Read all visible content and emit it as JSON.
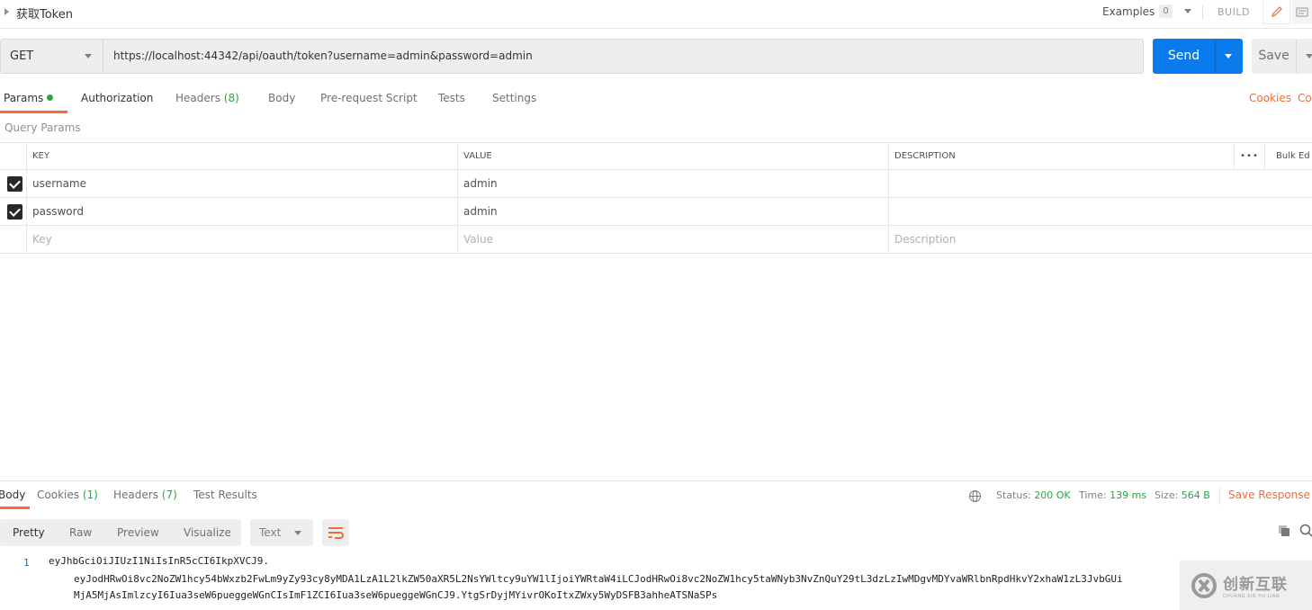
{
  "request": {
    "name": "获取Token",
    "examples_label": "Examples",
    "examples_count": "0",
    "build_label": "BUILD",
    "method": "GET",
    "url": "https://localhost:44342/api/oauth/token?username=admin&password=admin",
    "send_label": "Send",
    "save_label": "Save"
  },
  "request_tabs": [
    {
      "label": "Params",
      "suffix": "",
      "active": true,
      "has_dot": true
    },
    {
      "label": "Authorization",
      "suffix": ""
    },
    {
      "label": "Headers",
      "suffix": "(8)"
    },
    {
      "label": "Body",
      "suffix": ""
    },
    {
      "label": "Pre-request Script",
      "suffix": ""
    },
    {
      "label": "Tests",
      "suffix": ""
    },
    {
      "label": "Settings",
      "suffix": ""
    }
  ],
  "right_links": {
    "cookies": "Cookies",
    "code": "Co"
  },
  "query_params": {
    "section_label": "Query Params",
    "headers": {
      "key": "KEY",
      "value": "VALUE",
      "description": "DESCRIPTION",
      "more": "•••",
      "bulk_edit": "Bulk Ed"
    },
    "rows": [
      {
        "checked": true,
        "key": "username",
        "value": "admin",
        "description": ""
      },
      {
        "checked": true,
        "key": "password",
        "value": "admin",
        "description": ""
      }
    ],
    "placeholders": {
      "key": "Key",
      "value": "Value",
      "description": "Description"
    }
  },
  "response": {
    "tabs": [
      {
        "label": "Body",
        "suffix": "",
        "active": true
      },
      {
        "label": "Cookies",
        "suffix": "(1)"
      },
      {
        "label": "Headers",
        "suffix": "(7)"
      },
      {
        "label": "Test Results",
        "suffix": ""
      }
    ],
    "status_label": "Status:",
    "status_value": "200 OK",
    "time_label": "Time:",
    "time_value": "139 ms",
    "size_label": "Size:",
    "size_value": "564 B",
    "save_response": "Save Response",
    "formats": [
      "Pretty",
      "Raw",
      "Preview",
      "Visualize"
    ],
    "active_format": "Pretty",
    "type_select": "Text",
    "body_line_number": "1",
    "body_lines": [
      "eyJhbGciOiJIUzI1NiIsInR5cCI6IkpXVCJ9.",
      "eyJodHRwOi8vc2NoZW1hcy54bWxzb2FwLm9yZy93cy8yMDA1LzA1L2lkZW50aXR5L2NsYWltcy9uYW1lIjoiYWRtaW4iLCJodHRwOi8vc2NoZW1hcy5taWNyb3NvZnQuY29tL3dzLzIwMDgvMDYvaWRlbnRpdHkvY2xhaW1zL3JvbGUi",
      "MjA5MjAsImlzcyI6Iua3seW6pueggeWGnCIsImF1ZCI6Iua3seW6pueggeWGnCJ9.YtgSrDyjMYivrOKoItxZWxy5WyDSFB3ahheATSNaSPs"
    ]
  },
  "watermark": {
    "cn": "创新互联",
    "en": "CHUANG XIN HU LIAN"
  },
  "colors": {
    "accent": "#f26b3a",
    "send": "#097bed",
    "success": "#28a745"
  }
}
